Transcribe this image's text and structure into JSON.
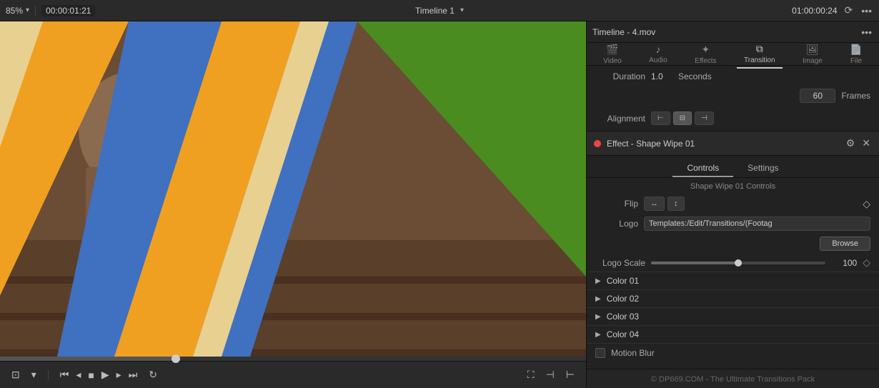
{
  "topbar": {
    "zoom": "85%",
    "timecode_left": "00:00:01:21",
    "timeline_name": "Timeline 1",
    "timecode_right": "01:00:00:24"
  },
  "panel": {
    "title": "Timeline - 4.mov",
    "tabs": [
      {
        "label": "Video",
        "icon": "🎬",
        "active": false
      },
      {
        "label": "Audio",
        "icon": "♪",
        "active": false
      },
      {
        "label": "Effects",
        "icon": "✦",
        "active": false
      },
      {
        "label": "Transition",
        "icon": "⧉",
        "active": true
      },
      {
        "label": "Image",
        "icon": "🖼",
        "active": false
      },
      {
        "label": "File",
        "icon": "📄",
        "active": false
      }
    ],
    "duration_label": "Duration",
    "duration_value": "1.0",
    "duration_unit": "Seconds",
    "frames_value": "60",
    "frames_label": "Frames",
    "alignment_label": "Alignment",
    "alignment_options": [
      "left",
      "center",
      "right"
    ],
    "effect_title": "Effect - Shape Wipe 01",
    "ctrl_tabs": [
      "Controls",
      "Settings"
    ],
    "active_ctrl_tab": "Controls",
    "section_title": "Shape Wipe 01 Controls",
    "flip_label": "Flip",
    "logo_label": "Logo",
    "logo_path": "Templates:/Edit/Transitions/(Footag",
    "browse_label": "Browse",
    "logo_scale_label": "Logo Scale",
    "logo_scale_value": "100",
    "color_items": [
      "Color 01",
      "Color 02",
      "Color 03",
      "Color 04"
    ],
    "motion_blur_label": "Motion Blur",
    "footer_text": "© DP669.COM - The Ultimate Transitions Pack"
  },
  "bottom_controls": {
    "zoom_icon": "⊡",
    "zoom_icon2": "▾",
    "prev_btn": "⏮",
    "step_back": "◂",
    "stop": "■",
    "play": "▶",
    "step_fwd": "▸",
    "next_btn": "⏭",
    "loop": "↻",
    "screen_icon": "⛶",
    "end_icon": "⊣",
    "last_icon": "⊢"
  }
}
